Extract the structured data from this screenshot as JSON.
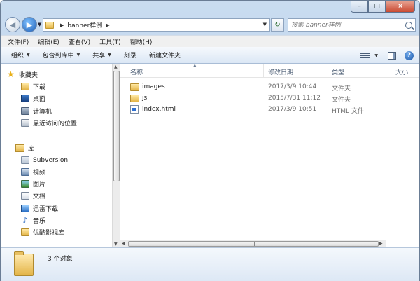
{
  "address": {
    "crumbs": [
      "banner样例"
    ]
  },
  "search": {
    "placeholder": "搜索 banner样例"
  },
  "menu": [
    "文件(F)",
    "编辑(E)",
    "查看(V)",
    "工具(T)",
    "帮助(H)"
  ],
  "toolbar": {
    "organize": "组织",
    "include_library": "包含到库中",
    "share": "共享",
    "burn": "刻录",
    "new_folder": "新建文件夹"
  },
  "nav": {
    "favorites": "收藏夹",
    "favorites_items": [
      "下载",
      "桌面",
      "计算机",
      "最近访问的位置"
    ],
    "libraries": "库",
    "library_items": [
      "Subversion",
      "视频",
      "图片",
      "文档",
      "迅雷下载",
      "音乐",
      "优酷影视库"
    ]
  },
  "columns": {
    "name": "名称",
    "modified": "修改日期",
    "type": "类型",
    "size": "大小"
  },
  "files": [
    {
      "name": "images",
      "modified": "2017/3/9 10:44",
      "type": "文件夹",
      "icon": "folder-icon"
    },
    {
      "name": "js",
      "modified": "2015/7/31 11:12",
      "type": "文件夹",
      "icon": "folder-icon"
    },
    {
      "name": "index.html",
      "modified": "2017/3/9 10:51",
      "type": "HTML 文件",
      "icon": "html-file-icon"
    }
  ],
  "status": {
    "item_count": "3 个对象"
  },
  "caption": {
    "minimize": "–",
    "maximize": "□",
    "close": "×"
  }
}
